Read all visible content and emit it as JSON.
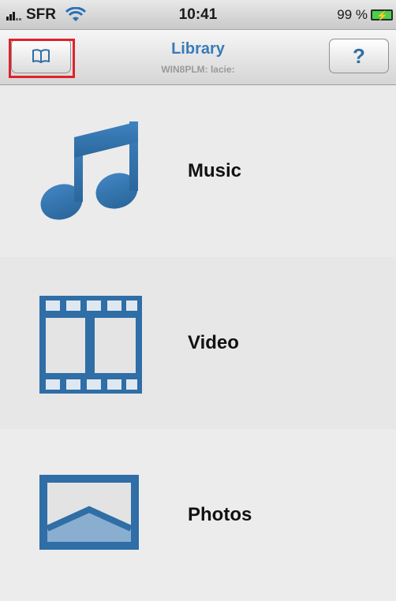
{
  "status_bar": {
    "carrier": "SFR",
    "time": "10:41",
    "battery": "99 %"
  },
  "nav": {
    "title": "Library",
    "subtitle": "WIN8PLM: lacie:",
    "help_label": "?",
    "left_icon": "book-icon"
  },
  "library": {
    "items": [
      {
        "label": "Music",
        "icon": "music-note-icon"
      },
      {
        "label": "Video",
        "icon": "film-strip-icon"
      },
      {
        "label": "Photos",
        "icon": "photo-icon"
      }
    ]
  },
  "colors": {
    "accent": "#3a7ab8",
    "icon_blue": "#2f6ea6",
    "highlight": "#e0212b"
  }
}
